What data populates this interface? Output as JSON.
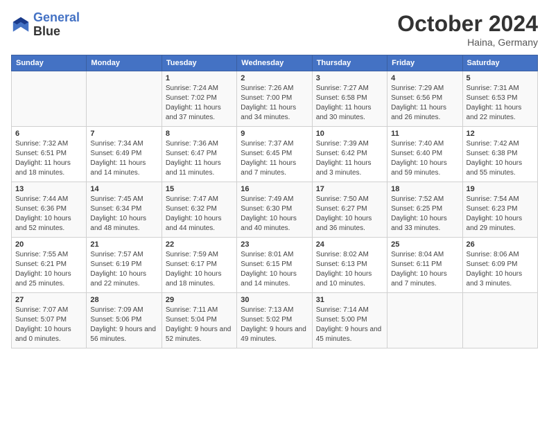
{
  "header": {
    "logo_line1": "General",
    "logo_line2": "Blue",
    "month_title": "October 2024",
    "location": "Haina, Germany"
  },
  "weekdays": [
    "Sunday",
    "Monday",
    "Tuesday",
    "Wednesday",
    "Thursday",
    "Friday",
    "Saturday"
  ],
  "weeks": [
    [
      {
        "day": "",
        "sunrise": "",
        "sunset": "",
        "daylight": ""
      },
      {
        "day": "",
        "sunrise": "",
        "sunset": "",
        "daylight": ""
      },
      {
        "day": "1",
        "sunrise": "Sunrise: 7:24 AM",
        "sunset": "Sunset: 7:02 PM",
        "daylight": "Daylight: 11 hours and 37 minutes."
      },
      {
        "day": "2",
        "sunrise": "Sunrise: 7:26 AM",
        "sunset": "Sunset: 7:00 PM",
        "daylight": "Daylight: 11 hours and 34 minutes."
      },
      {
        "day": "3",
        "sunrise": "Sunrise: 7:27 AM",
        "sunset": "Sunset: 6:58 PM",
        "daylight": "Daylight: 11 hours and 30 minutes."
      },
      {
        "day": "4",
        "sunrise": "Sunrise: 7:29 AM",
        "sunset": "Sunset: 6:56 PM",
        "daylight": "Daylight: 11 hours and 26 minutes."
      },
      {
        "day": "5",
        "sunrise": "Sunrise: 7:31 AM",
        "sunset": "Sunset: 6:53 PM",
        "daylight": "Daylight: 11 hours and 22 minutes."
      }
    ],
    [
      {
        "day": "6",
        "sunrise": "Sunrise: 7:32 AM",
        "sunset": "Sunset: 6:51 PM",
        "daylight": "Daylight: 11 hours and 18 minutes."
      },
      {
        "day": "7",
        "sunrise": "Sunrise: 7:34 AM",
        "sunset": "Sunset: 6:49 PM",
        "daylight": "Daylight: 11 hours and 14 minutes."
      },
      {
        "day": "8",
        "sunrise": "Sunrise: 7:36 AM",
        "sunset": "Sunset: 6:47 PM",
        "daylight": "Daylight: 11 hours and 11 minutes."
      },
      {
        "day": "9",
        "sunrise": "Sunrise: 7:37 AM",
        "sunset": "Sunset: 6:45 PM",
        "daylight": "Daylight: 11 hours and 7 minutes."
      },
      {
        "day": "10",
        "sunrise": "Sunrise: 7:39 AM",
        "sunset": "Sunset: 6:42 PM",
        "daylight": "Daylight: 11 hours and 3 minutes."
      },
      {
        "day": "11",
        "sunrise": "Sunrise: 7:40 AM",
        "sunset": "Sunset: 6:40 PM",
        "daylight": "Daylight: 10 hours and 59 minutes."
      },
      {
        "day": "12",
        "sunrise": "Sunrise: 7:42 AM",
        "sunset": "Sunset: 6:38 PM",
        "daylight": "Daylight: 10 hours and 55 minutes."
      }
    ],
    [
      {
        "day": "13",
        "sunrise": "Sunrise: 7:44 AM",
        "sunset": "Sunset: 6:36 PM",
        "daylight": "Daylight: 10 hours and 52 minutes."
      },
      {
        "day": "14",
        "sunrise": "Sunrise: 7:45 AM",
        "sunset": "Sunset: 6:34 PM",
        "daylight": "Daylight: 10 hours and 48 minutes."
      },
      {
        "day": "15",
        "sunrise": "Sunrise: 7:47 AM",
        "sunset": "Sunset: 6:32 PM",
        "daylight": "Daylight: 10 hours and 44 minutes."
      },
      {
        "day": "16",
        "sunrise": "Sunrise: 7:49 AM",
        "sunset": "Sunset: 6:30 PM",
        "daylight": "Daylight: 10 hours and 40 minutes."
      },
      {
        "day": "17",
        "sunrise": "Sunrise: 7:50 AM",
        "sunset": "Sunset: 6:27 PM",
        "daylight": "Daylight: 10 hours and 36 minutes."
      },
      {
        "day": "18",
        "sunrise": "Sunrise: 7:52 AM",
        "sunset": "Sunset: 6:25 PM",
        "daylight": "Daylight: 10 hours and 33 minutes."
      },
      {
        "day": "19",
        "sunrise": "Sunrise: 7:54 AM",
        "sunset": "Sunset: 6:23 PM",
        "daylight": "Daylight: 10 hours and 29 minutes."
      }
    ],
    [
      {
        "day": "20",
        "sunrise": "Sunrise: 7:55 AM",
        "sunset": "Sunset: 6:21 PM",
        "daylight": "Daylight: 10 hours and 25 minutes."
      },
      {
        "day": "21",
        "sunrise": "Sunrise: 7:57 AM",
        "sunset": "Sunset: 6:19 PM",
        "daylight": "Daylight: 10 hours and 22 minutes."
      },
      {
        "day": "22",
        "sunrise": "Sunrise: 7:59 AM",
        "sunset": "Sunset: 6:17 PM",
        "daylight": "Daylight: 10 hours and 18 minutes."
      },
      {
        "day": "23",
        "sunrise": "Sunrise: 8:01 AM",
        "sunset": "Sunset: 6:15 PM",
        "daylight": "Daylight: 10 hours and 14 minutes."
      },
      {
        "day": "24",
        "sunrise": "Sunrise: 8:02 AM",
        "sunset": "Sunset: 6:13 PM",
        "daylight": "Daylight: 10 hours and 10 minutes."
      },
      {
        "day": "25",
        "sunrise": "Sunrise: 8:04 AM",
        "sunset": "Sunset: 6:11 PM",
        "daylight": "Daylight: 10 hours and 7 minutes."
      },
      {
        "day": "26",
        "sunrise": "Sunrise: 8:06 AM",
        "sunset": "Sunset: 6:09 PM",
        "daylight": "Daylight: 10 hours and 3 minutes."
      }
    ],
    [
      {
        "day": "27",
        "sunrise": "Sunrise: 7:07 AM",
        "sunset": "Sunset: 5:07 PM",
        "daylight": "Daylight: 10 hours and 0 minutes."
      },
      {
        "day": "28",
        "sunrise": "Sunrise: 7:09 AM",
        "sunset": "Sunset: 5:06 PM",
        "daylight": "Daylight: 9 hours and 56 minutes."
      },
      {
        "day": "29",
        "sunrise": "Sunrise: 7:11 AM",
        "sunset": "Sunset: 5:04 PM",
        "daylight": "Daylight: 9 hours and 52 minutes."
      },
      {
        "day": "30",
        "sunrise": "Sunrise: 7:13 AM",
        "sunset": "Sunset: 5:02 PM",
        "daylight": "Daylight: 9 hours and 49 minutes."
      },
      {
        "day": "31",
        "sunrise": "Sunrise: 7:14 AM",
        "sunset": "Sunset: 5:00 PM",
        "daylight": "Daylight: 9 hours and 45 minutes."
      },
      {
        "day": "",
        "sunrise": "",
        "sunset": "",
        "daylight": ""
      },
      {
        "day": "",
        "sunrise": "",
        "sunset": "",
        "daylight": ""
      }
    ]
  ]
}
